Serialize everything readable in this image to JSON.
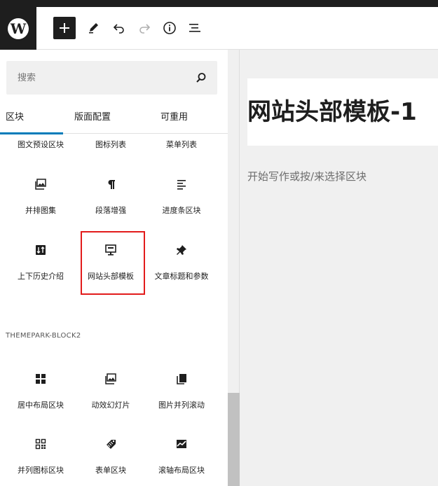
{
  "toolbar": {
    "logo_letter": "W"
  },
  "search": {
    "placeholder": "搜索"
  },
  "tabs": [
    "区块",
    "版面配置",
    "可重用"
  ],
  "blocks_row0": [
    "图文预设区块",
    "图标列表",
    "菜单列表"
  ],
  "blocks_row1": [
    {
      "label": "并排图集",
      "icon": "gallery-icon"
    },
    {
      "label": "段落增强",
      "icon": "paragraph-icon"
    },
    {
      "label": "进度条区块",
      "icon": "align-left-icon"
    }
  ],
  "blocks_row2": [
    {
      "label": "上下历史介绍",
      "icon": "sort-icon"
    },
    {
      "label": "网站头部模板",
      "icon": "desktop-icon"
    },
    {
      "label": "文章标题和参数",
      "icon": "pin-icon"
    }
  ],
  "section_title": "THEMEPARK-BLOCK2",
  "blocks_row3": [
    {
      "label": "居中布局区块",
      "icon": "grid-icon"
    },
    {
      "label": "动效幻灯片",
      "icon": "gallery-icon"
    },
    {
      "label": "图片并列滚动",
      "icon": "copy-icon"
    }
  ],
  "blocks_row4": [
    {
      "label": "并列图标区块",
      "icon": "qrcode-icon"
    },
    {
      "label": "表单区块",
      "icon": "tag-icon"
    },
    {
      "label": "滚轴布局区块",
      "icon": "chart-icon"
    }
  ],
  "editor": {
    "title": "网站头部模板-1",
    "placeholder": "开始写作或按/来选择区块"
  },
  "colors": {
    "accent": "#007cba",
    "highlight": "#e21b1b",
    "dark": "#1e1e1e"
  }
}
